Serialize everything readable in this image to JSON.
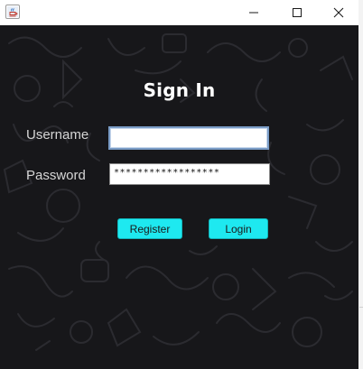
{
  "window": {
    "icon": "java-app-icon",
    "controls": {
      "minimize_icon": "minimize-icon",
      "maximize_icon": "maximize-icon",
      "close_icon": "close-icon"
    }
  },
  "form": {
    "title": "Sign In",
    "username_label": "Username",
    "username_value": "",
    "password_label": "Password",
    "password_value": "******************",
    "register_label": "Register",
    "login_label": "Login"
  },
  "colors": {
    "background": "#17171a",
    "doodle": "#2b2b30",
    "button": "#1ee9f0",
    "focus_border": "#7a9cc6"
  }
}
